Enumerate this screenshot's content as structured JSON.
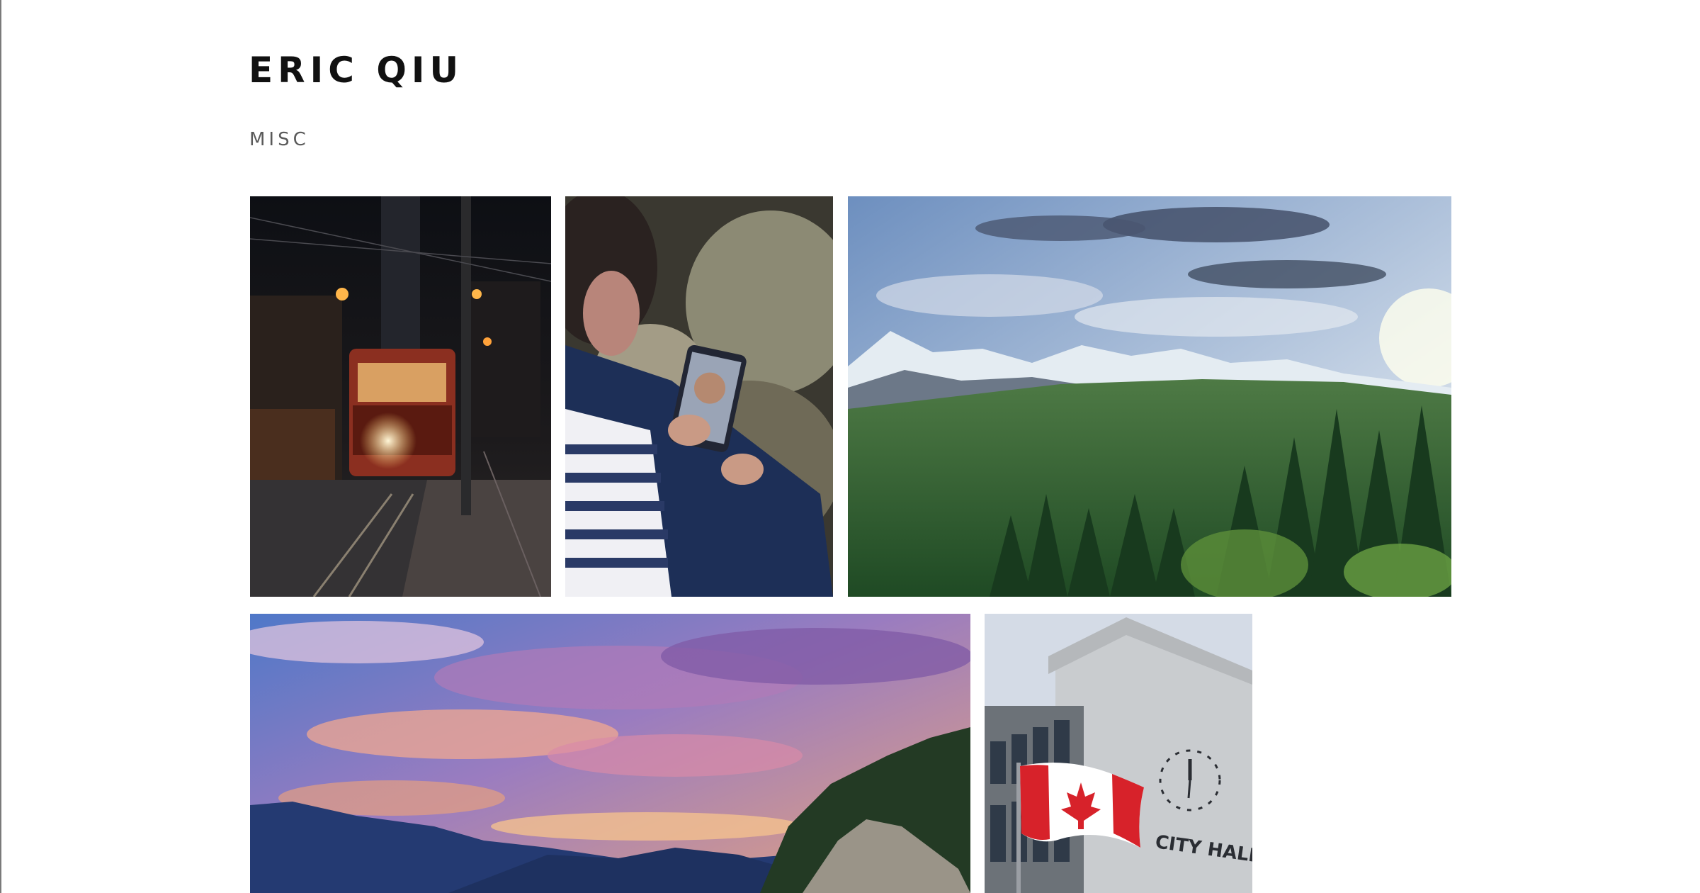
{
  "header": {
    "title": "ERIC QIU",
    "section": "MISC"
  },
  "sign": {
    "text": "CITY HALL"
  },
  "gallery": {
    "photos": [
      {
        "subject": "night-streetcar"
      },
      {
        "subject": "phone-selfie"
      },
      {
        "subject": "mountain-forest"
      },
      {
        "subject": "sunset-sky"
      },
      {
        "subject": "city-hall-flag"
      }
    ]
  },
  "colors": {
    "text_primary": "#111111",
    "text_secondary": "#5a5a5a",
    "background": "#ffffff"
  }
}
